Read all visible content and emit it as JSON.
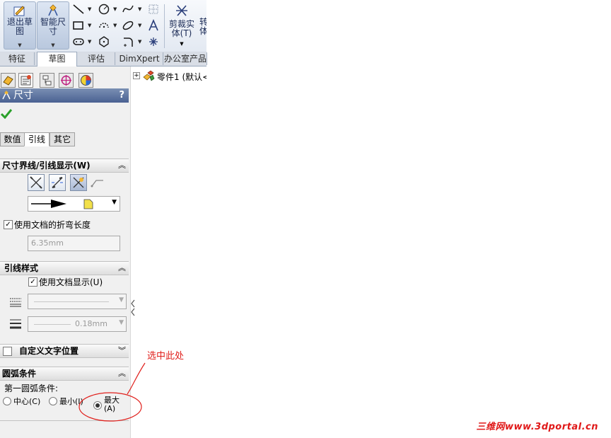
{
  "toolbar": {
    "exit_sketch_line1": "退出草",
    "exit_sketch_line2": "图",
    "smart_dim_line1": "智能尺",
    "smart_dim_line2": "寸",
    "trim_line1": "剪裁实",
    "trim_line2": "体(T)",
    "convert_line1": "转",
    "convert_line2": "体"
  },
  "main_tabs": [
    "特征",
    "草图",
    "评估",
    "DimXpert",
    "办公室产品"
  ],
  "active_main_tab": "草图",
  "property_manager": {
    "title": "尺寸",
    "help": "?",
    "subtabs": [
      "数值",
      "引线",
      "其它"
    ],
    "active_subtab": "引线",
    "group_witness": {
      "header": "尺寸界线/引线显示(W)",
      "use_doc_bend_label": "使用文档的折弯长度",
      "use_doc_bend_checked": true,
      "bend_length_value": "6.35mm"
    },
    "group_leader_style": {
      "header": "引线样式",
      "use_doc_display_label": "使用文档显示(U)",
      "use_doc_display_checked": true,
      "thickness_value": "0.18mm"
    },
    "group_custom_text": {
      "header": "自定义文字位置",
      "checked": false
    },
    "group_arc": {
      "header": "圆弧条件",
      "first_arc_label": "第一圆弧条件:",
      "options": [
        {
          "label": "中心(C)",
          "selected": false
        },
        {
          "label": "最小(I)",
          "selected": false
        },
        {
          "label_line1": "最大",
          "label_line2": "(A)",
          "selected": true
        }
      ]
    }
  },
  "tree": {
    "root_item": "零件1 (默认<"
  },
  "annotation": {
    "text": "选中此处",
    "color": "#e0201c"
  },
  "watermark": "三维网www.3dportal.cn"
}
